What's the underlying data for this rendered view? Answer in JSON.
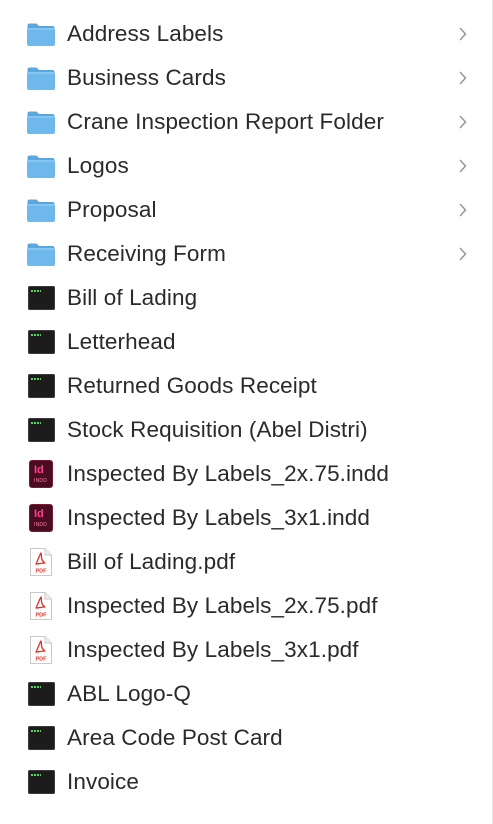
{
  "files": [
    {
      "name": "Address Labels",
      "kind": "folder"
    },
    {
      "name": "Business Cards",
      "kind": "folder"
    },
    {
      "name": "Crane Inspection Report Folder",
      "kind": "folder"
    },
    {
      "name": "Logos",
      "kind": "folder"
    },
    {
      "name": "Proposal",
      "kind": "folder"
    },
    {
      "name": "Receiving Form",
      "kind": "folder"
    },
    {
      "name": "Bill of Lading",
      "kind": "exec"
    },
    {
      "name": "Letterhead",
      "kind": "exec"
    },
    {
      "name": "Returned Goods Receipt",
      "kind": "exec"
    },
    {
      "name": "Stock Requisition (Abel Distri)",
      "kind": "exec"
    },
    {
      "name": "Inspected By Labels_2x.75.indd",
      "kind": "indd"
    },
    {
      "name": "Inspected By Labels_3x1.indd",
      "kind": "indd"
    },
    {
      "name": "Bill of Lading.pdf",
      "kind": "pdf"
    },
    {
      "name": "Inspected By Labels_2x.75.pdf",
      "kind": "pdf"
    },
    {
      "name": "Inspected By Labels_3x1.pdf",
      "kind": "pdf"
    },
    {
      "name": "ABL Logo-Q",
      "kind": "exec"
    },
    {
      "name": "Area Code Post Card",
      "kind": "exec"
    },
    {
      "name": "Invoice",
      "kind": "exec"
    }
  ],
  "icons": {
    "folder": "folder-icon",
    "exec": "executable-file-icon",
    "indd": "indesign-file-icon",
    "pdf": "pdf-file-icon",
    "chevron": "chevron-right-icon"
  },
  "indd_badge": {
    "big": "Id",
    "small": "INDD"
  },
  "pdf_badge": "PDF",
  "colors": {
    "folder_fill": "#6fb8ec",
    "folder_tab": "#5aa7e0",
    "text": "#2a2a2a",
    "chevron": "#9a9a9a",
    "indd_bg": "#4a0c20",
    "indd_text": "#ff3f8e",
    "pdf_red": "#e2322a",
    "exec_green": "#5ad15a"
  }
}
